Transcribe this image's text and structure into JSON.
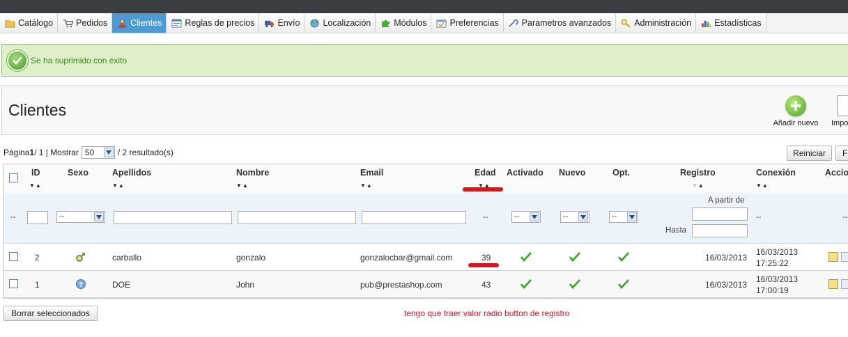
{
  "nav": {
    "tabs": [
      {
        "label": "Catálogo",
        "icon": "folder-icon",
        "active": false
      },
      {
        "label": "Pedidos",
        "icon": "cart-icon",
        "active": false
      },
      {
        "label": "Clientes",
        "icon": "user-icon",
        "active": true
      },
      {
        "label": "Reglas de precios",
        "icon": "price-rules-icon",
        "active": false
      },
      {
        "label": "Envío",
        "icon": "truck-icon",
        "active": false
      },
      {
        "label": "Localización",
        "icon": "globe-icon",
        "active": false
      },
      {
        "label": "Módulos",
        "icon": "puzzle-icon",
        "active": false
      },
      {
        "label": "Preferencias",
        "icon": "preferences-icon",
        "active": false
      },
      {
        "label": "Parametros avanzados",
        "icon": "wrench-icon",
        "active": false
      },
      {
        "label": "Administración",
        "icon": "key-icon",
        "active": false
      },
      {
        "label": "Estadísticas",
        "icon": "stats-icon",
        "active": false
      }
    ]
  },
  "alert": {
    "message": "Se ha suprimido con éxito"
  },
  "page": {
    "title": "Clientes",
    "add_label": "Añadir nuevo",
    "import_label": "Impor"
  },
  "pagination": {
    "page_prefix": "Página ",
    "current": "1",
    "of": " / 1 | Mostrar ",
    "per_page": "50",
    "results": " / 2 resultado(s)",
    "reset_label": "Reiniciar",
    "filter_label": "Fi"
  },
  "table": {
    "headers": {
      "id": "ID",
      "sex": "Sexo",
      "lastname": "Apellidos",
      "firstname": "Nombre",
      "email": "Email",
      "age": "Edad",
      "active": "Activado",
      "new": "Nuevo",
      "optin": "Opt.",
      "registered": "Registro",
      "connection": "Conexión",
      "actions": "Accio"
    },
    "filters": {
      "placeholder_dash": "--",
      "select_default": "--",
      "from_label": "A partir de",
      "to_label": "Hasta"
    },
    "rows": [
      {
        "id": "2",
        "sex_icon": "male-icon",
        "lastname": "carballo",
        "firstname": "gonzalo",
        "email": "gonzalocbar@gmail.com",
        "age": "39",
        "registered": "16/03/2013",
        "conn_date": "16/03/2013",
        "conn_time": "17:25:22"
      },
      {
        "id": "1",
        "sex_icon": "unknown-gender-icon",
        "lastname": "DOE",
        "firstname": "John",
        "email": "pub@prestashop.com",
        "age": "43",
        "registered": "16/03/2013",
        "conn_date": "16/03/2013",
        "conn_time": "17:00:19"
      }
    ]
  },
  "footer": {
    "bulk_delete_label": "Borrar seleccionados",
    "note": "tengo que traer valor radio button de registro"
  },
  "colors": {
    "accent": "#4a9bd6",
    "success_bg": "#dff0c8",
    "annotation_red": "#d7161e",
    "check_green": "#3aa02c"
  }
}
